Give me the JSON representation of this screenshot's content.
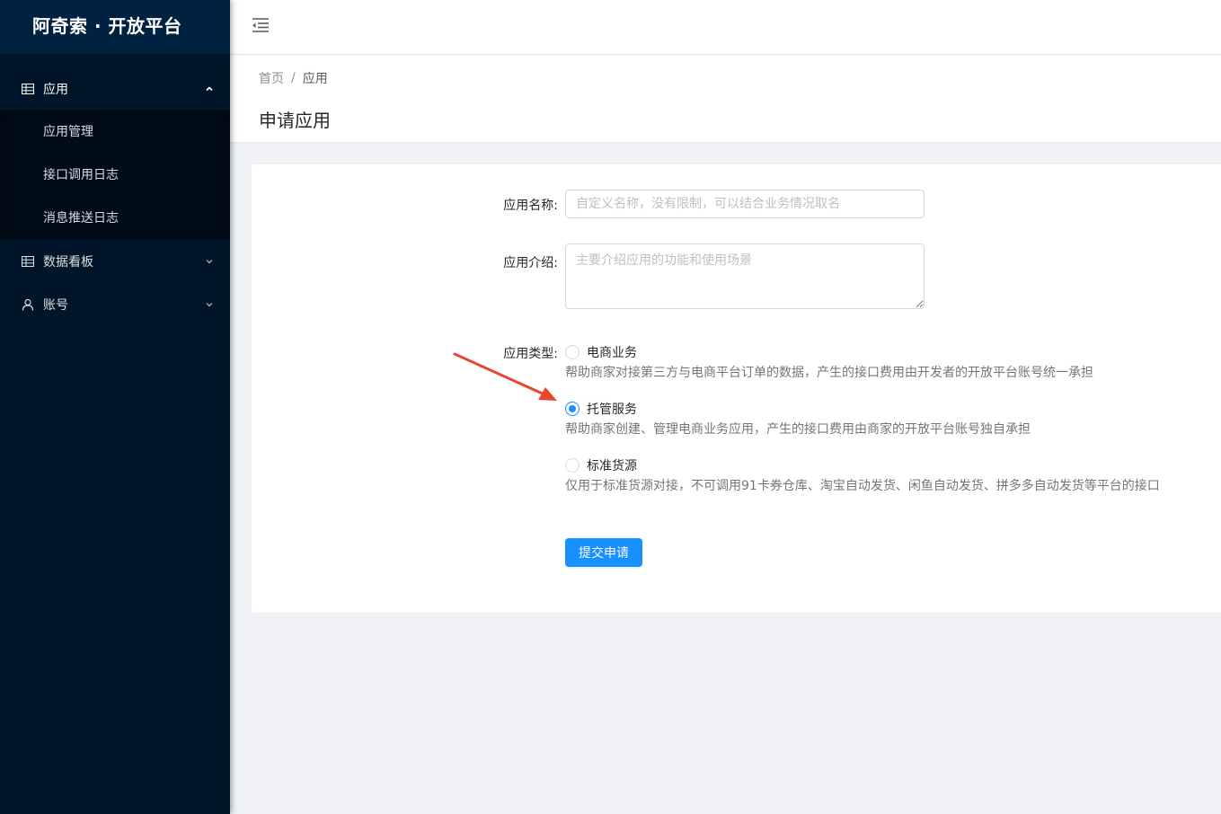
{
  "app": {
    "title": "阿奇索 · 开放平台"
  },
  "sidebar": {
    "groups": [
      {
        "label": "应用",
        "icon": "table-icon",
        "open": true,
        "items": [
          {
            "label": "应用管理"
          },
          {
            "label": "接口调用日志"
          },
          {
            "label": "消息推送日志"
          }
        ]
      },
      {
        "label": "数据看板",
        "icon": "table-icon",
        "open": false
      },
      {
        "label": "账号",
        "icon": "user-icon",
        "open": false
      }
    ]
  },
  "header": {
    "menu_toggle_icon": "menu-fold-icon"
  },
  "breadcrumb": {
    "home": "首页",
    "separator": "/",
    "current": "应用"
  },
  "page": {
    "title": "申请应用"
  },
  "form": {
    "name": {
      "label": "应用名称:",
      "value": "",
      "placeholder": "自定义名称，没有限制，可以结合业务情况取名"
    },
    "intro": {
      "label": "应用介绍:",
      "value": "",
      "placeholder": "主要介绍应用的功能和使用场景"
    },
    "type": {
      "label": "应用类型:",
      "options": [
        {
          "label": "电商业务",
          "desc": "帮助商家对接第三方与电商平台订单的数据，产生的接口费用由开发者的开放平台账号统一承担",
          "checked": false
        },
        {
          "label": "托管服务",
          "desc": "帮助商家创建、管理电商业务应用，产生的接口费用由商家的开放平台账号独自承担",
          "checked": true
        },
        {
          "label": "标准货源",
          "desc": "仅用于标准货源对接，不可调用91卡券仓库、淘宝自动发货、闲鱼自动发货、拼多多自动发货等平台的接口",
          "checked": false
        }
      ]
    },
    "submit_label": "提交申请"
  },
  "colors": {
    "sidebar_bg": "#001529",
    "primary": "#1890ff",
    "annotation_arrow": "#e8472d"
  }
}
